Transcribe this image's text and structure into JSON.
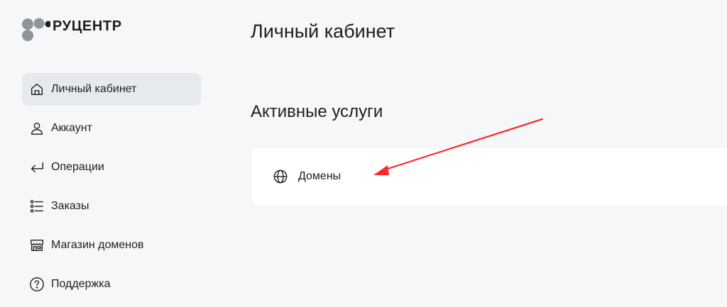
{
  "brand": {
    "name": "РУЦЕНТР",
    "dot_colors": [
      "#8f959b",
      "#8f959b",
      "#1e1e1e",
      "#8f959b"
    ]
  },
  "sidebar": {
    "items": [
      {
        "label": "Личный кабинет",
        "icon": "home-icon",
        "active": true
      },
      {
        "label": "Аккаунт",
        "icon": "user-icon",
        "active": false
      },
      {
        "label": "Операции",
        "icon": "return-arrow-icon",
        "active": false
      },
      {
        "label": "Заказы",
        "icon": "list-icon",
        "active": false
      },
      {
        "label": "Магазин доменов",
        "icon": "store-icon",
        "active": false
      },
      {
        "label": "Поддержка",
        "icon": "help-circle-icon",
        "active": false
      }
    ]
  },
  "main": {
    "title": "Личный кабинет",
    "section_title": "Активные услуги",
    "services": [
      {
        "label": "Домены",
        "icon": "globe-icon"
      }
    ]
  },
  "annotation": {
    "type": "arrow",
    "color": "#ff2a2a"
  },
  "colors": {
    "background": "#f6f7f8",
    "active_nav": "#e6eaee",
    "card": "#ffffff",
    "text": "#1e1e1e"
  }
}
